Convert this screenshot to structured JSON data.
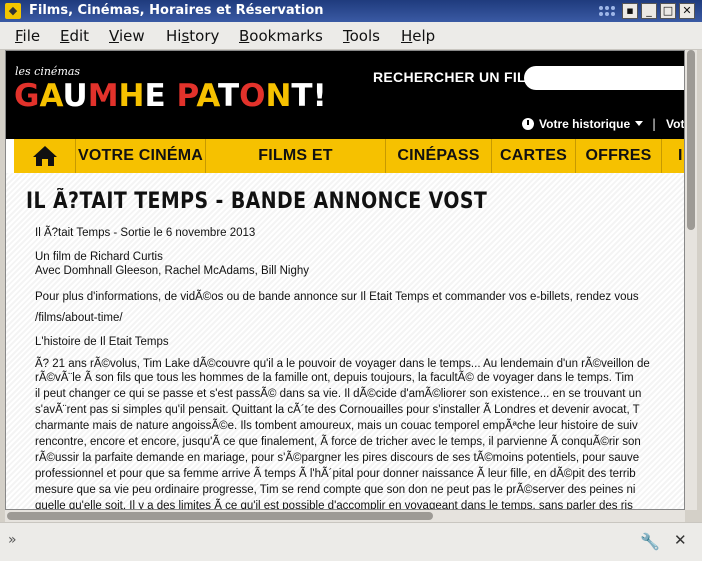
{
  "window": {
    "title": "Films, Cinémas, Horaires et Réservation",
    "icon": "firefox-icon"
  },
  "menubar": {
    "items": [
      "File",
      "Edit",
      "View",
      "History",
      "Bookmarks",
      "Tools",
      "Help"
    ],
    "underline": [
      "F",
      "E",
      "V",
      "s",
      "B",
      "T",
      "H"
    ]
  },
  "site": {
    "logo_small": "les cinémas",
    "logo_big": "GAUMHE PATONT!",
    "search_label": "RECHERCHER UN FILM",
    "search_placeholder": "",
    "history_label": "Votre historique",
    "history_label_2": "Vot",
    "separator": "|",
    "nav": [
      "VOTRE CINÉMA",
      "FILMS ET ÉVÉNEMENTS",
      "CINÉPASS",
      "CARTES",
      "OFFRES",
      "I"
    ]
  },
  "article": {
    "title": "IL Ã?TAIT TEMPS - BANDE ANNONCE VOST",
    "lines": [
      "Il Ã?tait Temps - Sortie le 6 novembre 2013",
      "",
      "Un film de Richard Curtis",
      "Avec Domhnall Gleeson, Rachel McAdams, Bill Nighy",
      "",
      "Pour plus d'informations, de vidÃ©os ou de bande annonce sur Il Etait Temps et commander vos e-billets, rendez vous",
      "/films/about-time/",
      "",
      "L'histoire de Il Etait Temps",
      "Ã? 21 ans rÃ©volus, Tim Lake dÃ©couvre qu'il a le pouvoir de voyager dans le temps... Au lendemain d'un rÃ©veillon de",
      "rÃ©vÃ¨le Ã  son fils que tous les hommes de la famille ont, depuis toujours, la facultÃ© de voyager dans le temps. Tim",
      "il peut changer ce qui se passe et s'est passÃ© dans sa vie. Il dÃ©cide d'amÃ©liorer son existence... en se trouvant un",
      "s'avÃ¨rent pas si simples qu'il pensait. Quittant la cÃ´te des Cornouailles pour s'installer Ã  Londres et devenir avocat, T",
      "charmante mais de nature angoissÃ©e. Ils tombent amoureux, mais un couac temporel empÃªche leur histoire de suiv",
      "rencontre, encore et encore, jusqu'Ã  ce que finalement, Ã  force de tricher avec le temps, il parvienne Ã  conquÃ©rir son",
      "rÃ©ussir la parfaite demande en mariage, pour s'Ã©pargner les pires discours de ses tÃ©moins potentiels, pour sauve",
      "professionnel et pour que sa femme arrive Ã  temps Ã  l'hÃ´pital pour donner naissance Ã  leur fille, en dÃ©pit des terrib",
      "mesure que sa vie peu ordinaire progresse, Tim se rend compte que son don ne peut pas le prÃ©server des peines ni",
      "quelle qu'elle soit. Il y a des limites Ã  ce qu'il est possible d'accomplir en voyageant dans le temps, sans parler des ris"
    ]
  },
  "colors": {
    "nav_bg": "#f6c100",
    "header_bg": "#000000",
    "logo_red": "#e2322b",
    "logo_yellow": "#f6c100",
    "logo_white": "#ffffff"
  }
}
